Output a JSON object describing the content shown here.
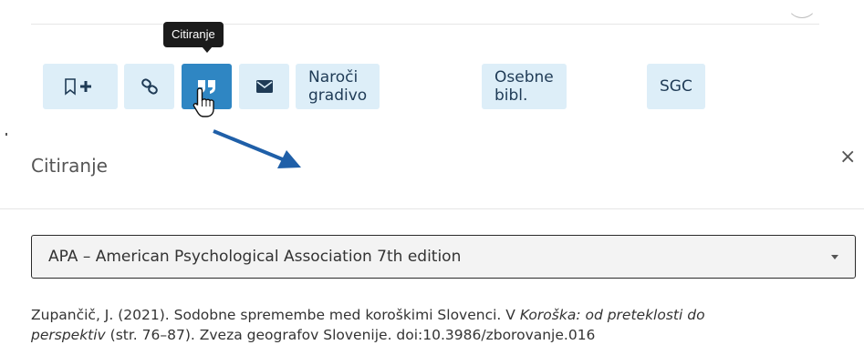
{
  "tooltip": {
    "text": "Citiranje"
  },
  "toolbar": {
    "buttons": [
      {
        "icon": "bookmark-add-icon"
      },
      {
        "icon": "link-icon"
      },
      {
        "icon": "quote-icon",
        "active": true
      },
      {
        "icon": "envelope-icon"
      }
    ],
    "order_label": "Naroči gradivo",
    "personal_label": "Osebne bibl.",
    "sgc_label": "SGC"
  },
  "modal": {
    "title": "Citiranje",
    "close_symbol": "×",
    "style_select": {
      "value": "APA – American Psychological Association 7th edition"
    },
    "citation": {
      "part1": "Zupančič, J. (2021). Sodobne spremembe med koroškimi Slovenci. V ",
      "italic1": "Koroška: od preteklosti do",
      "italic2": "perspektiv",
      "part2": " (str. 76–87). Zveza geografov Slovenije. doi:10.3986/zborovanje.016"
    }
  },
  "colors": {
    "button_bg": "#ddeef8",
    "button_active": "#2f86c3",
    "arrow": "#1f5fa8"
  }
}
